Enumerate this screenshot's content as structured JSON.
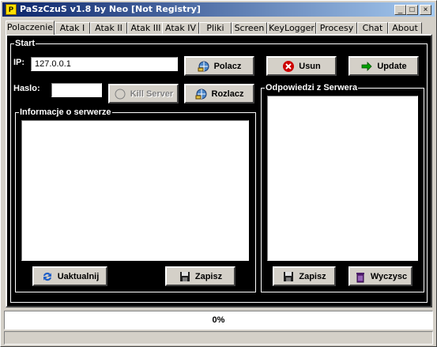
{
  "window": {
    "title": "PaSzCzuS v1.8 by Neo [Not Registry]",
    "app_icon_glyph": "P",
    "minimize_glyph": "_",
    "maximize_glyph": "□",
    "close_glyph": "×"
  },
  "tabs": [
    {
      "label": "Polaczenie",
      "active": true
    },
    {
      "label": "Atak I"
    },
    {
      "label": "Atak II"
    },
    {
      "label": "Atak III"
    },
    {
      "label": "Atak IV"
    },
    {
      "label": "Pliki"
    },
    {
      "label": "Screen"
    },
    {
      "label": "KeyLogger"
    },
    {
      "label": "Procesy"
    },
    {
      "label": "Chat"
    },
    {
      "label": "About"
    }
  ],
  "start": {
    "title": "Start",
    "ip_label": "IP:",
    "ip_value": "127.0.0.1",
    "password_label": "Haslo:",
    "password_value": "",
    "connect_button": "Polacz",
    "disconnect_button": "Rozlacz",
    "kill_server_button": "Kill Server",
    "remove_button": "Usun",
    "update_button": "Update"
  },
  "server_info": {
    "title": "Informacje o serwerze",
    "refresh_button": "Uaktualnij",
    "save_button": "Zapisz"
  },
  "server_responses": {
    "title": "Odpowiedzi z Serwera",
    "save_button": "Zapisz",
    "clear_button": "Wyczysc"
  },
  "status": {
    "progress_text": "0%",
    "progress": 0
  },
  "colors": {
    "panel_background": "#000000",
    "title_gradient_start": "#0a246a",
    "title_gradient_end": "#a6caf0",
    "remove_icon": "#cc0000",
    "update_icon": "#00a000"
  }
}
